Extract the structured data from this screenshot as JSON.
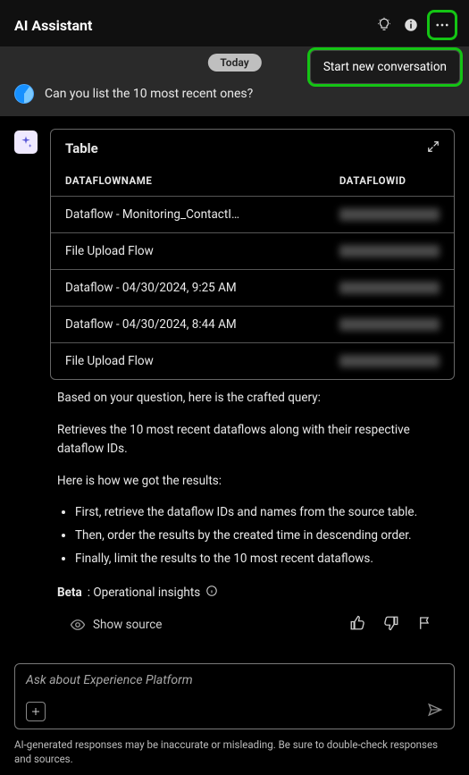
{
  "header": {
    "title": "AI Assistant"
  },
  "popover": {
    "start_new": "Start new conversation"
  },
  "chat": {
    "date_label": "Today",
    "user_message": "Can you list the 10 most recent ones?"
  },
  "table": {
    "title": "Table",
    "columns": {
      "name": "DATAFLOWNAME",
      "id": "DATAFLOWID"
    },
    "rows": [
      {
        "name": "Dataflow - Monitoring_ContactI…"
      },
      {
        "name": "File Upload Flow"
      },
      {
        "name": "Dataflow - 04/30/2024, 9:25 AM"
      },
      {
        "name": "Dataflow - 04/30/2024, 8:44 AM"
      },
      {
        "name": "File Upload Flow"
      }
    ]
  },
  "explain": {
    "intro": "Based on your question, here is the crafted query:",
    "summary": "Retrieves the 10 most recent dataflows along with their respective dataflow IDs.",
    "how_label": "Here is how we got the results:",
    "steps": [
      "First, retrieve the dataflow IDs and names from the source table.",
      "Then, order the results by the created time in descending order.",
      "Finally, limit the results to the 10 most recent dataflows."
    ],
    "beta_label": "Beta",
    "beta_text": ": Operational insights",
    "show_source": "Show source"
  },
  "input": {
    "placeholder": "Ask about Experience Platform"
  },
  "disclaimer": "AI-generated responses may be inaccurate or misleading. Be sure to double-check responses and sources."
}
